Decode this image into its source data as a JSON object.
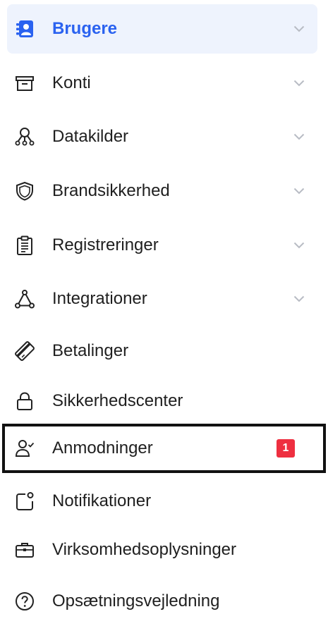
{
  "colors": {
    "accent": "#2a62f0",
    "active_background": "#eef3fd",
    "badge": "#ee2f40",
    "text": "#1f1f1f",
    "chevron": "#b8bcc4",
    "highlight_border": "#111111"
  },
  "nav": {
    "items": [
      {
        "label": "Brugere",
        "icon": "users-icon",
        "expandable": true,
        "active": true
      },
      {
        "label": "Konti",
        "icon": "archive-box-icon",
        "expandable": true
      },
      {
        "label": "Datakilder",
        "icon": "data-sources-icon",
        "expandable": true
      },
      {
        "label": "Brandsikkerhed",
        "icon": "shield-icon",
        "expandable": true
      },
      {
        "label": "Registreringer",
        "icon": "clipboard-icon",
        "expandable": true
      },
      {
        "label": "Integrationer",
        "icon": "integration-icon",
        "expandable": true
      },
      {
        "label": "Betalinger",
        "icon": "credit-card-icon",
        "expandable": false
      },
      {
        "label": "Sikkerhedscenter",
        "icon": "lock-icon",
        "expandable": false
      },
      {
        "label": "Anmodninger",
        "icon": "user-check-icon",
        "expandable": false,
        "badge": "1",
        "highlighted": true
      },
      {
        "label": "Notifikationer",
        "icon": "notification-icon",
        "expandable": false
      },
      {
        "label": "Virksomhedsoplysninger",
        "icon": "briefcase-icon",
        "expandable": false
      },
      {
        "label": "Opsætningsvejledning",
        "icon": "help-circle-icon",
        "expandable": false
      }
    ]
  }
}
